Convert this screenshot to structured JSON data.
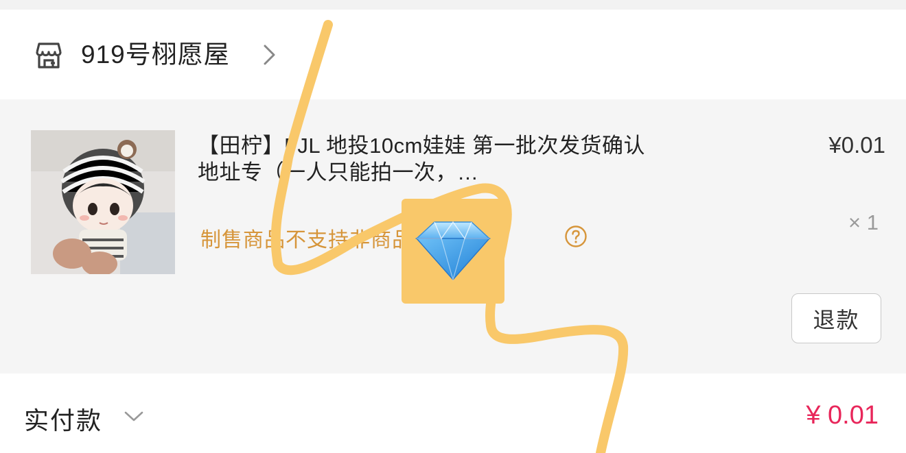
{
  "shop": {
    "name": "919号栩愿屋",
    "icon": "store-icon",
    "chevron_icon": "chevron-right-icon"
  },
  "product": {
    "title": "【田柠】FJL 地投10cm娃娃 第一批次发货确认地址专（一人只能拍一次，…",
    "price": "¥0.01",
    "quantity": "× 1",
    "notice": "制售商品不支持非商品问题退款",
    "help_icon": "question-circle-icon",
    "refund_label": "退款"
  },
  "payment": {
    "label": "实付款",
    "amount": "¥ 0.01",
    "chevron_icon": "chevron-down-icon"
  },
  "colors": {
    "notice": "#d6953a",
    "amount": "#e8265a",
    "scribble": "#f9c86a",
    "background": "#f5f5f5"
  },
  "overlay": {
    "badge_icon": "diamond-icon"
  }
}
